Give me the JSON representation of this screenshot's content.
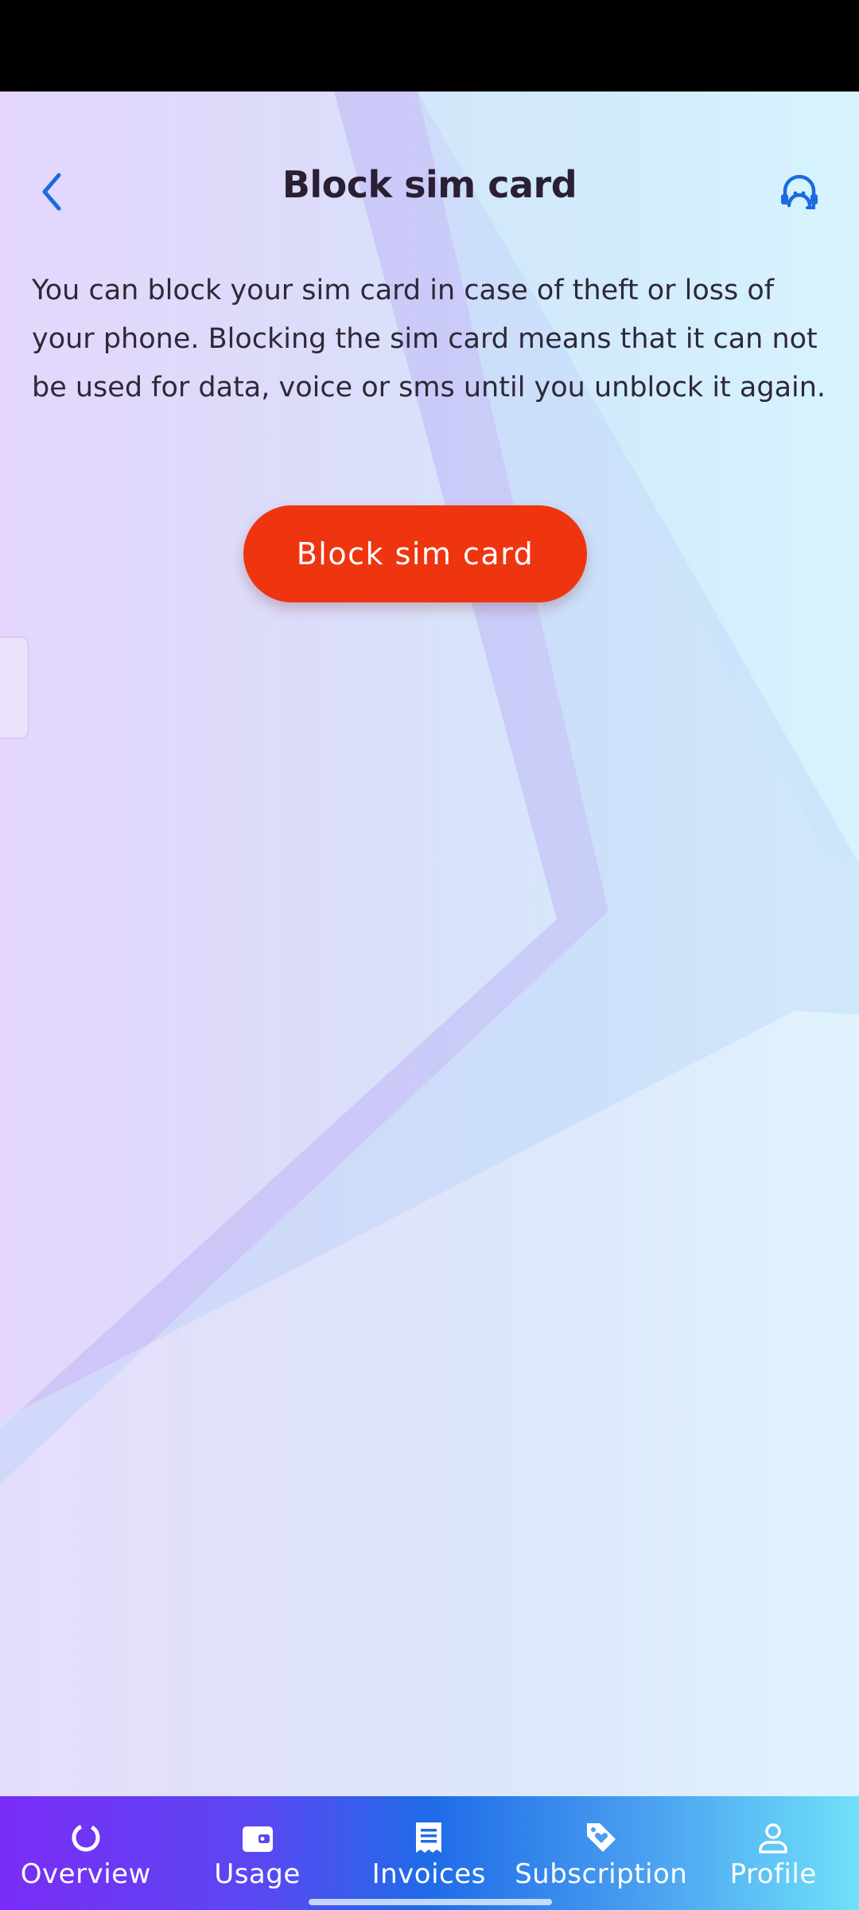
{
  "header": {
    "title": "Block sim card",
    "back_icon": "chevron-left-icon",
    "support_icon": "headset-support-icon"
  },
  "content": {
    "description": "You can block your sim card in case of theft or loss of your phone. Blocking the sim card means that it can not be used for data, voice or sms until you unblock it again.",
    "block_button_label": "Block sim card"
  },
  "bottom_nav": {
    "items": [
      {
        "label": "Overview",
        "icon": "circle-progress-icon"
      },
      {
        "label": "Usage",
        "icon": "wallet-icon"
      },
      {
        "label": "Invoices",
        "icon": "receipt-icon"
      },
      {
        "label": "Subscription",
        "icon": "tag-heart-icon"
      },
      {
        "label": "Profile",
        "icon": "person-icon"
      }
    ]
  },
  "colors": {
    "accent": "#1a6be0",
    "primary_button": "#ee3510",
    "title_text": "#2a1f33"
  }
}
